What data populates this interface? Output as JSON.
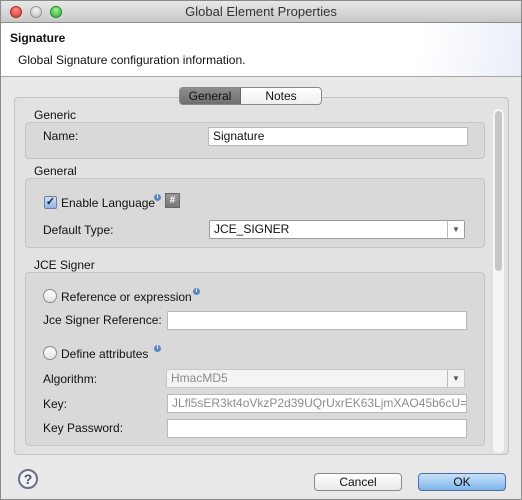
{
  "window": {
    "title": "Global Element Properties"
  },
  "header": {
    "title": "Signature",
    "description": "Global Signature configuration information."
  },
  "tabs": [
    {
      "label": "General",
      "active": true
    },
    {
      "label": "Notes",
      "active": false
    }
  ],
  "generic": {
    "label": "Generic",
    "name_label": "Name:",
    "name_value": "Signature"
  },
  "general": {
    "label": "General",
    "enable_language_label": "Enable Language",
    "enable_language_checked": true,
    "default_type_label": "Default Type:",
    "default_type_value": "JCE_SIGNER"
  },
  "jce": {
    "label": "JCE Signer",
    "reference_radio": "Reference or expression",
    "reference_label": "Jce Signer Reference:",
    "reference_value": "",
    "define_radio": "Define attributes",
    "algorithm_label": "Algorithm:",
    "algorithm_value": "HmacMD5",
    "key_label": "Key:",
    "key_value": "JLfl5sER3kt4oVkzP2d39UQrUxrEK63LjmXAO45b6cU=",
    "key_password_label": "Key Password:",
    "key_password_value": ""
  },
  "footer": {
    "help_icon": "?",
    "cancel": "Cancel",
    "ok": "OK"
  },
  "colors": {
    "ok_button": "#7fb5ea",
    "close": "#e0443e",
    "minimize": "#bdbdbd",
    "maximize": "#3ec43e"
  }
}
